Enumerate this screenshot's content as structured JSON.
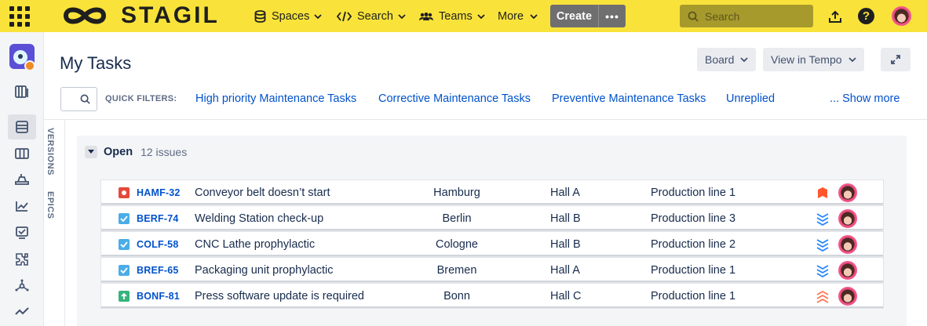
{
  "topbar": {
    "logo_text": "STAGIL",
    "nav": [
      {
        "label": "Spaces",
        "icon": "database-icon"
      },
      {
        "label": "Search",
        "icon": "code-icon"
      },
      {
        "label": "Teams",
        "icon": "people-icon"
      },
      {
        "label": "More",
        "icon": ""
      }
    ],
    "create_label": "Create",
    "create_more": "•••",
    "search_placeholder": "Search"
  },
  "header": {
    "title": "My Tasks",
    "board_label": "Board",
    "tempo_label": "View in Tempo"
  },
  "filters": {
    "label": "QUICK FILTERS:",
    "items": [
      "High priority Maintenance Tasks",
      "Corrective Maintenance Tasks",
      "Preventive Maintenance Tasks",
      "Unreplied"
    ],
    "show_more": "... Show more"
  },
  "side_tabs": {
    "versions": "VERSIONS",
    "epics": "EPICS"
  },
  "group": {
    "name": "Open",
    "count": "12 issues"
  },
  "issues": [
    {
      "type": "bug",
      "key": "HAMF-32",
      "summary": "Conveyor belt doesn’t start",
      "city": "Hamburg",
      "hall": "Hall A",
      "line": "Production line 1",
      "priority": "highest"
    },
    {
      "type": "task",
      "key": "BERF-74",
      "summary": "Welding Station check-up",
      "city": "Berlin",
      "hall": "Hall B",
      "line": "Production line 3",
      "priority": "lowest"
    },
    {
      "type": "task",
      "key": "COLF-58",
      "summary": "CNC Lathe prophylactic",
      "city": "Cologne",
      "hall": "Hall B",
      "line": "Production line 2",
      "priority": "lowest"
    },
    {
      "type": "task",
      "key": "BREF-65",
      "summary": "Packaging unit prophylactic",
      "city": "Bremen",
      "hall": "Hall A",
      "line": "Production line 1",
      "priority": "lowest"
    },
    {
      "type": "improvement",
      "key": "BONF-81",
      "summary": "Press software update is required",
      "city": "Bonn",
      "hall": "Hall C",
      "line": "Production line 1",
      "priority": "high"
    }
  ],
  "colors": {
    "topbar": "#F9E33A",
    "link": "#0052CC",
    "bug": "#E5493A",
    "task": "#4BADE8",
    "improvement": "#36B37E",
    "priority_lowest": "#2684FF",
    "priority_high": "#FF5630"
  }
}
